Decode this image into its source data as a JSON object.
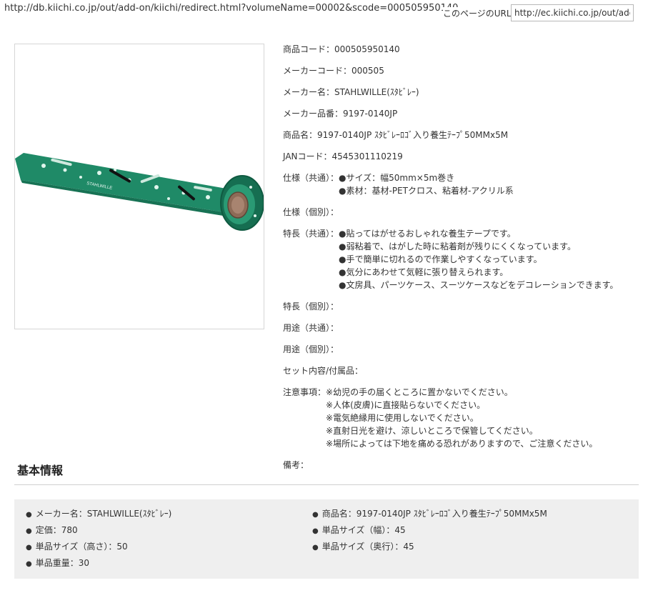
{
  "top_url": "http://db.kiichi.co.jp/out/add-on/kiichi/redirect.html?volumeName=00002&scode=000505950140",
  "page_url": {
    "label": "このページのURL",
    "value": "http://ec.kiichi.co.jp/out/add"
  },
  "product_image": {
    "brand_text": "STAHLWILLE"
  },
  "info": {
    "product_code": {
      "label": "商品コード：",
      "value": "000505950140"
    },
    "maker_code": {
      "label": "メーカーコード：",
      "value": "000505"
    },
    "maker_name": {
      "label": "メーカー名：",
      "value": "STAHLWILLE(ｽﾀﾋﾞﾚｰ)"
    },
    "maker_part_no": {
      "label": "メーカー品番：",
      "value": "9197-0140JP"
    },
    "product_name": {
      "label": "商品名：",
      "value": "9197-0140JP ｽﾀﾋﾞﾚｰﾛｺﾞ入り養生ﾃｰﾌﾟ50MMx5M"
    },
    "jan_code": {
      "label": "JANコード：",
      "value": "4545301110219"
    },
    "spec_common": {
      "label": "仕様（共通）：",
      "lines": [
        "●サイズ：幅50mm×5m巻き",
        "●素材：基材-PETクロス、粘着材-アクリル系"
      ]
    },
    "spec_individual": {
      "label": "仕様（個別）：",
      "value": ""
    },
    "features_common": {
      "label": "特長（共通）：",
      "lines": [
        "●貼ってはがせるおしゃれな養生テープです。",
        "●弱粘着で、はがした時に粘着剤が残りにくくなっています。",
        "●手で簡単に切れるので作業しやすくなっています。",
        "●気分にあわせて気軽に張り替えられます。",
        "●文房具、パーツケース、スーツケースなどをデコレーションできます。"
      ]
    },
    "features_individual": {
      "label": "特長（個別）：",
      "value": ""
    },
    "usage_common": {
      "label": "用途（共通）：",
      "value": ""
    },
    "usage_individual": {
      "label": "用途（個別）：",
      "value": ""
    },
    "set_contents": {
      "label": "セット内容/付属品：",
      "value": ""
    },
    "cautions": {
      "label": "注意事項：",
      "lines": [
        "※幼児の手の届くところに置かないでください。",
        "※人体(皮膚)に直接貼らないでください。",
        "※電気絶縁用に使用しないでください。",
        "※直射日光を避け、涼しいところで保管してください。",
        "※場所によっては下地を痛める恐れがありますので、ご注意ください。"
      ]
    },
    "remarks": {
      "label": "備考：",
      "value": ""
    }
  },
  "basic_info": {
    "title": "基本情報",
    "bullet": "●",
    "left": [
      "メーカー名：STAHLWILLE(ｽﾀﾋﾞﾚｰ)",
      "定価：780",
      "単品サイズ（高さ）：50",
      "単品重量：30"
    ],
    "right": [
      "商品名：9197-0140JP ｽﾀﾋﾞﾚｰﾛｺﾞ入り養生ﾃｰﾌﾟ50MMx5M",
      "単品サイズ（幅）：45",
      "単品サイズ（奥行）：45"
    ]
  }
}
